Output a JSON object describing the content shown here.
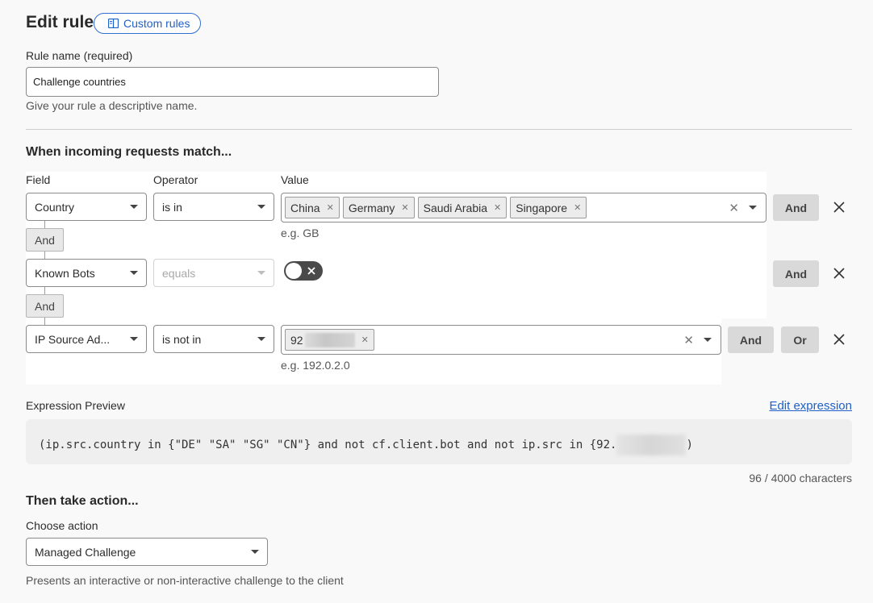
{
  "header": {
    "title": "Edit rule",
    "custom_rules_label": "Custom rules"
  },
  "rule_name": {
    "label": "Rule name (required)",
    "value": "Challenge countries",
    "help": "Give your rule a descriptive name."
  },
  "match": {
    "heading": "When incoming requests match...",
    "column_field": "Field",
    "column_operator": "Operator",
    "column_value": "Value",
    "rows": [
      {
        "field": "Country",
        "operator": "is in",
        "tags": [
          "China",
          "Germany",
          "Saudi Arabia",
          "Singapore"
        ],
        "example": "e.g. GB",
        "and_label": "And"
      },
      {
        "field": "Known Bots",
        "operator": "equals",
        "toggle_on": false,
        "and_label": "And"
      },
      {
        "field": "IP Source Ad...",
        "operator": "is not in",
        "tags": [
          "92"
        ],
        "example": "e.g. 192.0.2.0",
        "and_label": "And",
        "or_label": "Or"
      }
    ],
    "joins": [
      "And",
      "And"
    ]
  },
  "expression": {
    "label": "Expression Preview",
    "edit_link": "Edit expression",
    "text": "(ip.src.country in {\"DE\" \"SA\" \"SG\" \"CN\"} and not cf.client.bot and not ip.src in {92.",
    "text_end": ")",
    "char_count": "96 / 4000 characters"
  },
  "action": {
    "heading": "Then take action...",
    "label": "Choose action",
    "selected": "Managed Challenge",
    "help": "Presents an interactive or non-interactive challenge to the client"
  },
  "colors": {
    "accent": "#1f5fc7",
    "toggle_off": "#4a4a4a",
    "page_bg": "#f9f9f9"
  }
}
